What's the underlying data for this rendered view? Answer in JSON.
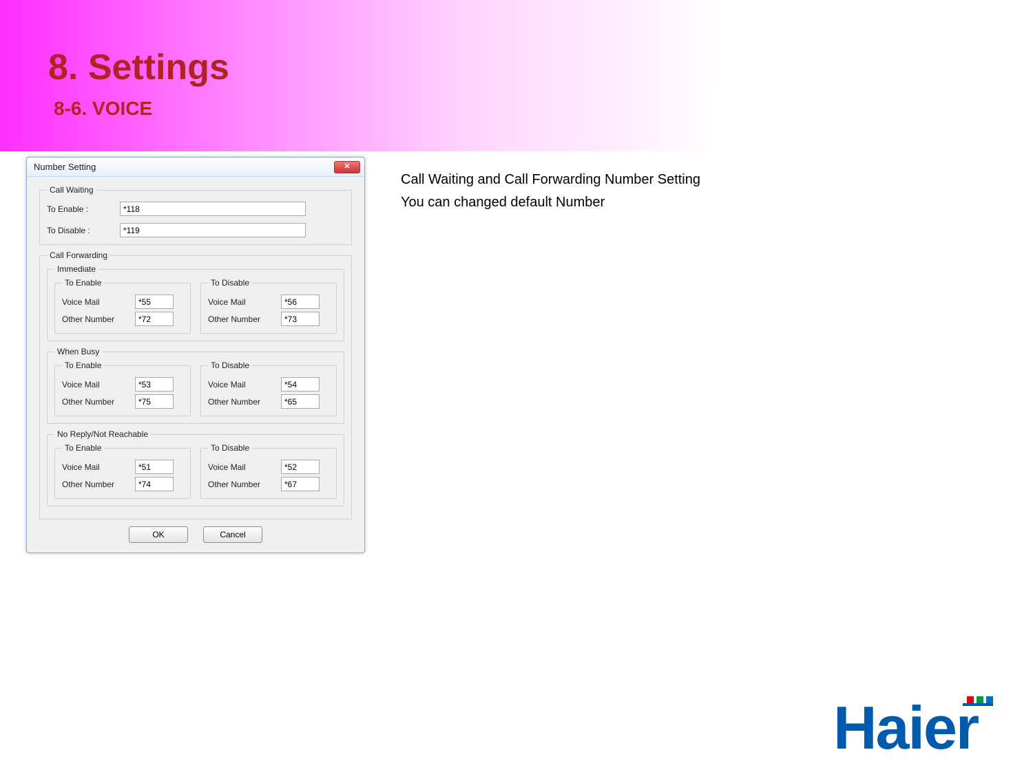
{
  "page": {
    "title": "8. Settings",
    "subtitle": "8-6. VOICE"
  },
  "dialog": {
    "title": "Number Setting",
    "close_glyph": "✕",
    "call_waiting": {
      "legend": "Call Waiting",
      "enable_label": "To Enable :",
      "enable_value": "*118",
      "disable_label": "To Disable :",
      "disable_value": "*119"
    },
    "call_forwarding": {
      "legend": "Call Forwarding",
      "groups": [
        {
          "legend": "Immediate",
          "enable": {
            "legend": "To Enable",
            "voice_label": "Voice Mail",
            "voice_value": "*55",
            "other_label": "Other Number",
            "other_value": "*72"
          },
          "disable": {
            "legend": "To Disable",
            "voice_label": "Voice Mail",
            "voice_value": "*56",
            "other_label": "Other Number",
            "other_value": "*73"
          }
        },
        {
          "legend": "When Busy",
          "enable": {
            "legend": "To Enable",
            "voice_label": "Voice Mail",
            "voice_value": "*53",
            "other_label": "Other Number",
            "other_value": "*75"
          },
          "disable": {
            "legend": "To Disable",
            "voice_label": "Voice Mail",
            "voice_value": "*54",
            "other_label": "Other Number",
            "other_value": "*65"
          }
        },
        {
          "legend": "No Reply/Not Reachable",
          "enable": {
            "legend": "To Enable",
            "voice_label": "Voice Mail",
            "voice_value": "*51",
            "other_label": "Other Number",
            "other_value": "*74"
          },
          "disable": {
            "legend": "To Disable",
            "voice_label": "Voice Mail",
            "voice_value": "*52",
            "other_label": "Other Number",
            "other_value": "*67"
          }
        }
      ]
    },
    "buttons": {
      "ok": "OK",
      "cancel": "Cancel"
    }
  },
  "side": {
    "line1": "Call Waiting and Call Forwarding Number Setting",
    "line2": "You can changed default Number"
  },
  "logo": {
    "text": "Haier"
  }
}
